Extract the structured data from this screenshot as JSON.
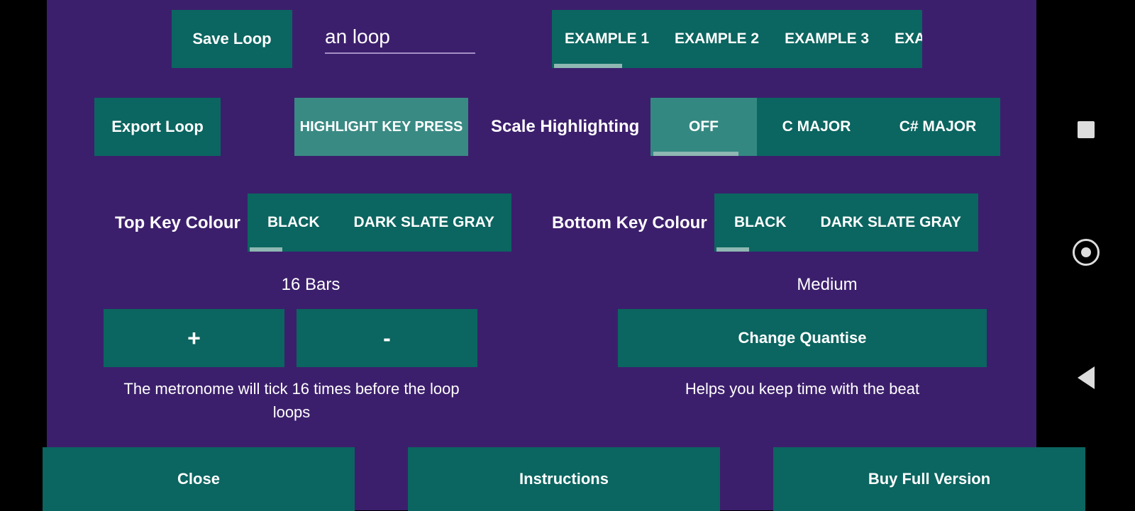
{
  "row1": {
    "save_loop": "Save Loop",
    "loop_name": "an loop",
    "example_tabs": [
      "EXAMPLE 1",
      "EXAMPLE 2",
      "EXAMPLE 3",
      "EXA"
    ]
  },
  "row2": {
    "export_loop": "Export Loop",
    "highlight_key": "HIGHLIGHT KEY PRESS",
    "scale_label": "Scale Highlighting",
    "scale_tabs": [
      "OFF",
      "C MAJOR",
      "C# MAJOR"
    ]
  },
  "row3": {
    "top_label": "Top Key Colour",
    "top_tabs": [
      "BLACK",
      "DARK SLATE GRAY"
    ],
    "bottom_label": "Bottom Key Colour",
    "bottom_tabs": [
      "BLACK",
      "DARK SLATE GRAY"
    ]
  },
  "row4": {
    "bars_label": "16 Bars",
    "plus": "+",
    "minus": "-",
    "bars_desc": "The metronome will tick 16 times before the loop loops",
    "quantise_label": "Medium",
    "change_quantise": "Change Quantise",
    "quantise_desc": "Helps you keep time with the beat"
  },
  "footer": {
    "close": "Close",
    "instructions": "Instructions",
    "buy": "Buy Full Version"
  }
}
